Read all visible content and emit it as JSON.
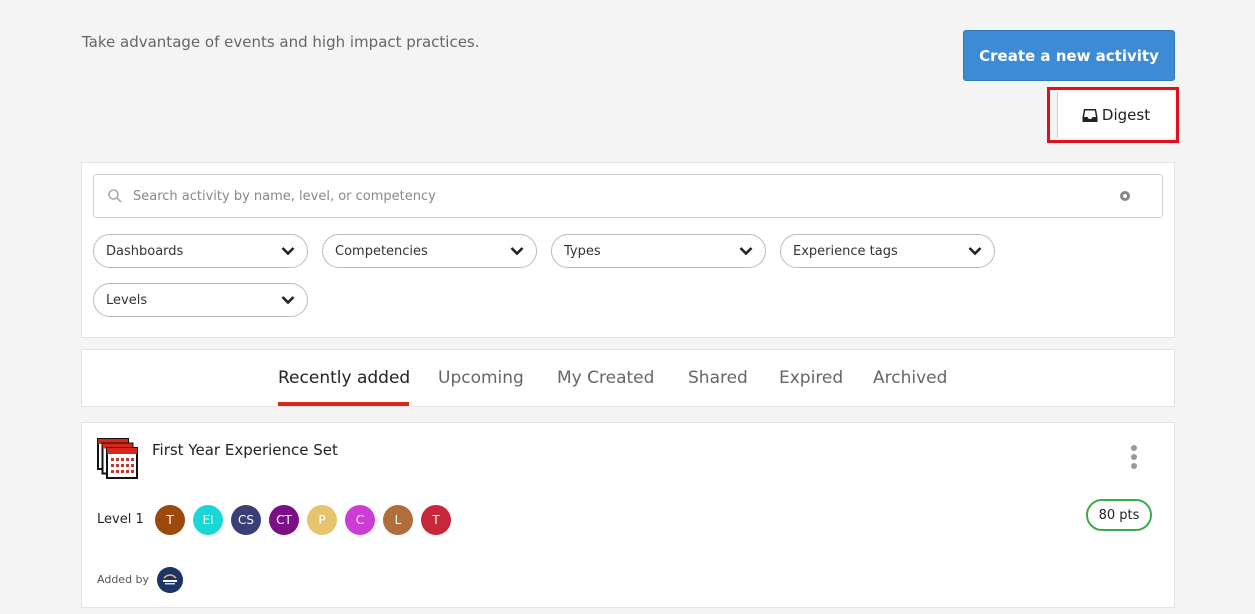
{
  "header": {
    "intro_text": "Take advantage of events and high impact practices.",
    "create_label": "Create a new activity",
    "digest_label": "Digest"
  },
  "filters": {
    "search_placeholder": "Search activity by name, level, or competency",
    "search_value": "",
    "dropdowns": [
      "Dashboards",
      "Competencies",
      "Types",
      "Experience tags",
      "Levels"
    ]
  },
  "tabs": [
    "Recently added",
    "Upcoming",
    "My Created",
    "Shared",
    "Expired",
    "Archived"
  ],
  "active_tab": "Recently added",
  "card": {
    "title": "First Year Experience Set",
    "level": "Level 1",
    "competencies": [
      {
        "label": "T",
        "color": "#9c4a0c"
      },
      {
        "label": "EI",
        "color": "#1ad6d6"
      },
      {
        "label": "CS",
        "color": "#3a3f78"
      },
      {
        "label": "CT",
        "color": "#7a0f86"
      },
      {
        "label": "P",
        "color": "#e6c46b"
      },
      {
        "label": "C",
        "color": "#cc3dd4"
      },
      {
        "label": "L",
        "color": "#b06e3c"
      },
      {
        "label": "T",
        "color": "#c8263a"
      }
    ],
    "points": "80 pts",
    "added_by_label": "Added by"
  },
  "colors": {
    "primary": "#3d8bd4",
    "highlight": "#e0101f",
    "tab_underline": "#d9261c",
    "points_border": "#3cab4a"
  }
}
